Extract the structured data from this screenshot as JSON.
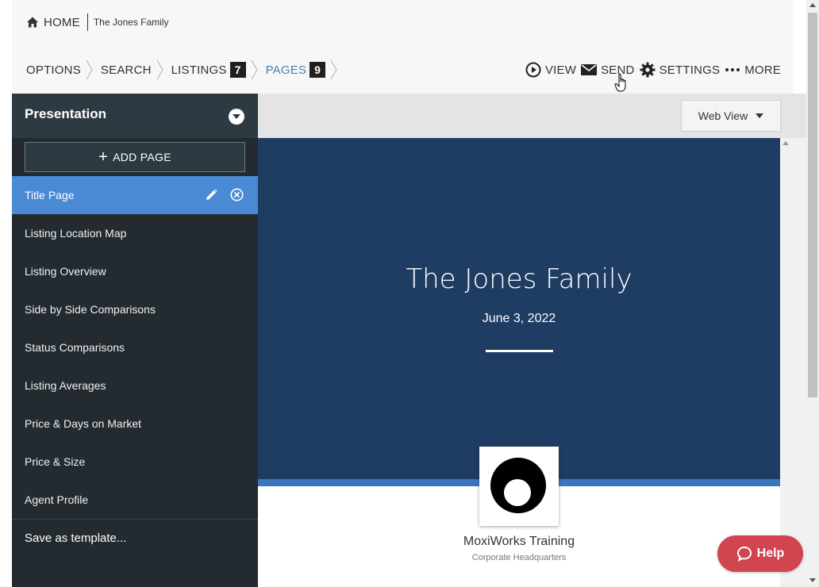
{
  "header": {
    "home_label": "HOME",
    "family_label": "The Jones Family"
  },
  "breadcrumb": {
    "items": [
      {
        "label": "OPTIONS",
        "badge": null
      },
      {
        "label": "SEARCH",
        "badge": null
      },
      {
        "label": "LISTINGS",
        "badge": "7"
      },
      {
        "label": "PAGES",
        "badge": "9"
      }
    ]
  },
  "actions": {
    "view": "VIEW",
    "send": "SEND",
    "settings": "SETTINGS",
    "more": "MORE"
  },
  "sidebar": {
    "title": "Presentation",
    "add_page_label": "ADD PAGE",
    "pages": [
      {
        "label": "Title Page"
      },
      {
        "label": "Listing Location Map"
      },
      {
        "label": "Listing Overview"
      },
      {
        "label": "Side by Side Comparisons"
      },
      {
        "label": "Status Comparisons"
      },
      {
        "label": "Listing Averages"
      },
      {
        "label": "Price & Days on Market"
      },
      {
        "label": "Price & Size"
      },
      {
        "label": "Agent Profile"
      }
    ],
    "save_template_label": "Save as template..."
  },
  "preview": {
    "view_mode": "Web View",
    "title": "The Jones Family",
    "date": "June 3, 2022",
    "company": "MoxiWorks Training",
    "office": "Corporate Headquarters"
  },
  "help": {
    "label": "Help"
  },
  "colors": {
    "accent": "#4a8ad4",
    "sidebar_bg": "#232b31",
    "hero_bg": "#1f3d63",
    "help_bg": "#d0454f"
  }
}
